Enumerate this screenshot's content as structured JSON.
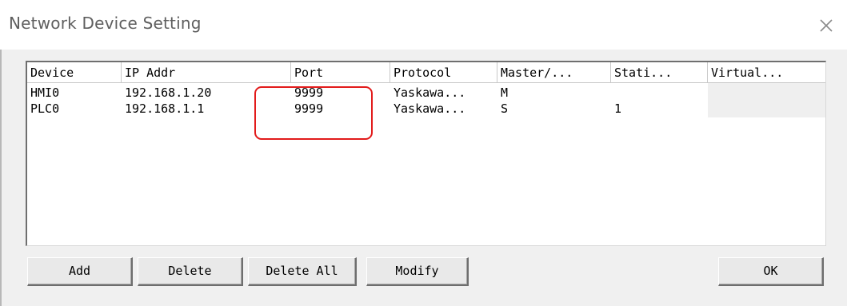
{
  "window": {
    "title": "Network Device Setting",
    "close_glyph": "×"
  },
  "table": {
    "columns": [
      {
        "label": "Device"
      },
      {
        "label": "IP Addr"
      },
      {
        "label": "Port"
      },
      {
        "label": "Protocol"
      },
      {
        "label": "Master/..."
      },
      {
        "label": "Stati..."
      },
      {
        "label": "Virtual..."
      }
    ],
    "rows": [
      {
        "device": "HMI0",
        "ip": "192.168.1.20",
        "port": "9999",
        "protocol": "Yaskawa...",
        "master": "M",
        "station": "",
        "virtual": ""
      },
      {
        "device": "PLC0",
        "ip": "192.168.1.1",
        "port": "9999",
        "protocol": "Yaskawa...",
        "master": "S",
        "station": "1",
        "virtual": ""
      }
    ]
  },
  "buttons": {
    "add": "Add",
    "delete": "Delete",
    "delete_all": "Delete All",
    "modify": "Modify",
    "ok": "OK"
  },
  "colors": {
    "highlight": "#e21b1b"
  }
}
